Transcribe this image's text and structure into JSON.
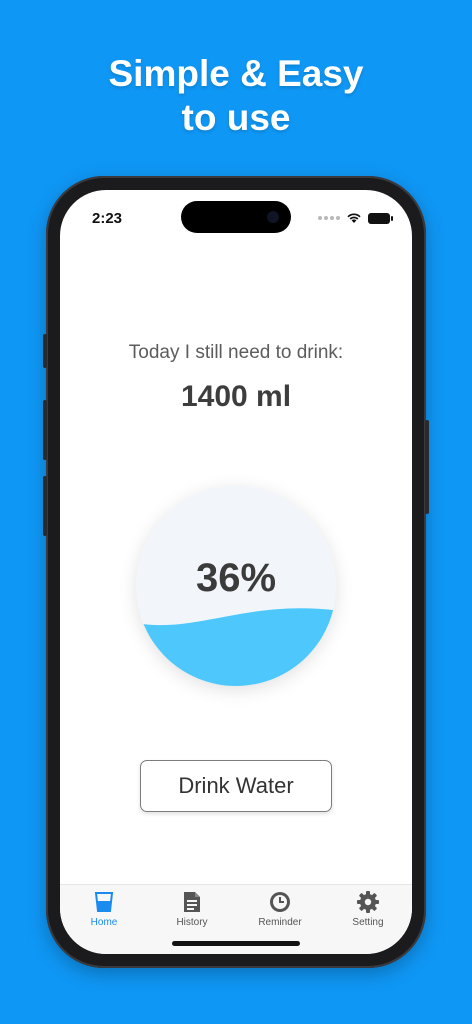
{
  "headline": {
    "line1": "Simple & Easy",
    "line2": "to use"
  },
  "status_bar": {
    "time": "2:23"
  },
  "main": {
    "need_label": "Today I still need to drink:",
    "remaining_amount": "1400 ml",
    "progress_text": "36%",
    "progress_fraction": 0.36,
    "drink_button_label": "Drink Water"
  },
  "tabbar": {
    "items": [
      {
        "label": "Home",
        "icon": "glass-icon",
        "active": true
      },
      {
        "label": "History",
        "icon": "document-icon",
        "active": false
      },
      {
        "label": "Reminder",
        "icon": "clock-icon",
        "active": false
      },
      {
        "label": "Setting",
        "icon": "gear-icon",
        "active": false
      }
    ]
  },
  "colors": {
    "background": "#0f97f5",
    "water": "#4ec8fc",
    "active_tab": "#1a8cf0"
  }
}
